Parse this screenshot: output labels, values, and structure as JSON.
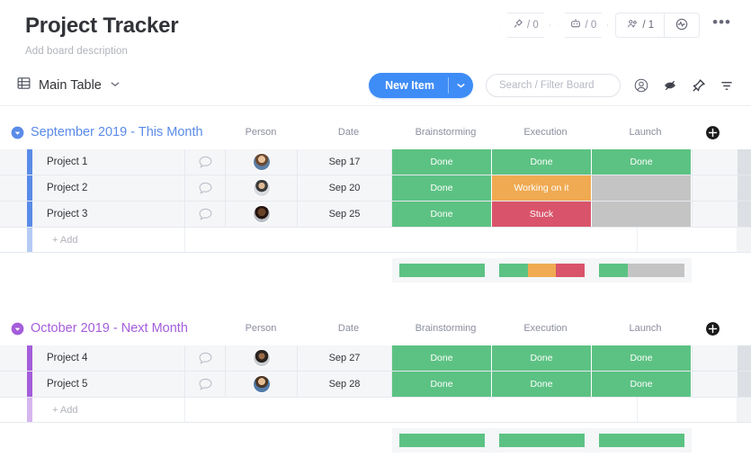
{
  "header": {
    "title": "Project Tracker",
    "description": "Add board description",
    "pills": [
      {
        "icon": "search-activity-icon",
        "count": "/ 0",
        "name": "activity-pill"
      },
      {
        "icon": "robot-icon",
        "count": "/ 0",
        "name": "automations-pill"
      }
    ],
    "members_count": "/ 1",
    "members_icon": "people-icon",
    "activity_icon": "pulse-icon",
    "more_label": "•••"
  },
  "toolbar": {
    "view_label": "Main Table",
    "view_icon": "table-icon",
    "chevron": "⌄",
    "new_item_label": "New Item",
    "new_item_arrow": "▼",
    "search_placeholder": "Search / Filter Board",
    "icons": [
      "person-circle-icon",
      "hide-eye-icon",
      "pin-icon",
      "filter-icon"
    ]
  },
  "columns": {
    "person": "Person",
    "date": "Date",
    "statuses": [
      "Brainstorming",
      "Execution",
      "Launch"
    ],
    "add_column": "+"
  },
  "colors": {
    "done": "#5cc283",
    "working": "#efaa52",
    "stuck": "#d9546a",
    "empty": "#c4c4c4",
    "group1": "#5a8be8",
    "group2": "#a45ddb",
    "accent_blue": "#3e8cf6"
  },
  "groups": [
    {
      "title": "September 2019 - This Month",
      "color": "#5a8be8",
      "add_label": "+ Add",
      "rows": [
        {
          "name": "Project 1",
          "date": "Sep 17",
          "avatar": "avatar-male-beard",
          "statuses": [
            {
              "label": "Done",
              "color": "#5cc283"
            },
            {
              "label": "Done",
              "color": "#5cc283"
            },
            {
              "label": "Done",
              "color": "#5cc283"
            }
          ]
        },
        {
          "name": "Project 2",
          "date": "Sep 20",
          "avatar": "avatar-curly-hair",
          "statuses": [
            {
              "label": "Done",
              "color": "#5cc283"
            },
            {
              "label": "Working on it",
              "color": "#efaa52"
            },
            {
              "label": "",
              "color": "#c4c4c4"
            }
          ]
        },
        {
          "name": "Project 3",
          "date": "Sep 25",
          "avatar": "avatar-dark-hair",
          "statuses": [
            {
              "label": "Done",
              "color": "#5cc283"
            },
            {
              "label": "Stuck",
              "color": "#d9546a"
            },
            {
              "label": "",
              "color": "#c4c4c4"
            }
          ]
        }
      ],
      "summary": [
        [
          {
            "color": "#5cc283",
            "pct": 100
          }
        ],
        [
          {
            "color": "#5cc283",
            "pct": 33.3
          },
          {
            "color": "#efaa52",
            "pct": 33.3
          },
          {
            "color": "#d9546a",
            "pct": 33.4
          }
        ],
        [
          {
            "color": "#5cc283",
            "pct": 33.3
          },
          {
            "color": "#c4c4c4",
            "pct": 66.7
          }
        ]
      ]
    },
    {
      "title": "October 2019 - Next Month",
      "color": "#a45ddb",
      "add_label": "+ Add",
      "rows": [
        {
          "name": "Project 4",
          "date": "Sep 27",
          "avatar": "avatar-dark-curly",
          "statuses": [
            {
              "label": "Done",
              "color": "#5cc283"
            },
            {
              "label": "Done",
              "color": "#5cc283"
            },
            {
              "label": "Done",
              "color": "#5cc283"
            }
          ]
        },
        {
          "name": "Project 5",
          "date": "Sep 28",
          "avatar": "avatar-male-smile",
          "statuses": [
            {
              "label": "Done",
              "color": "#5cc283"
            },
            {
              "label": "Done",
              "color": "#5cc283"
            },
            {
              "label": "Done",
              "color": "#5cc283"
            }
          ]
        }
      ],
      "summary": [
        [
          {
            "color": "#5cc283",
            "pct": 100
          }
        ],
        [
          {
            "color": "#5cc283",
            "pct": 100
          }
        ],
        [
          {
            "color": "#5cc283",
            "pct": 100
          }
        ]
      ]
    }
  ]
}
